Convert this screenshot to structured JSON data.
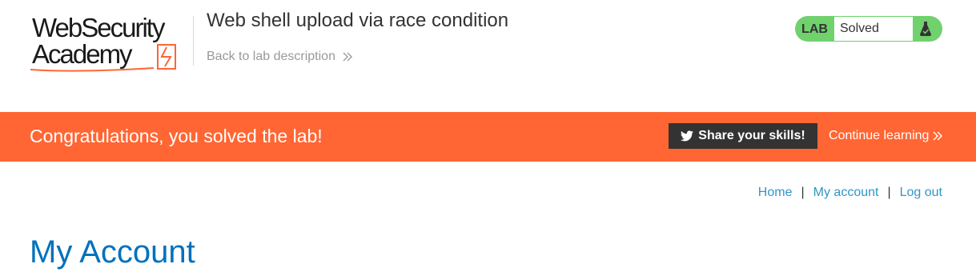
{
  "header": {
    "logo_line1": "WebSecurity",
    "logo_line2": "Academy",
    "lab_title": "Web shell upload via race condition",
    "back_link": "Back to lab description"
  },
  "status": {
    "tag": "LAB",
    "state": "Solved",
    "color": "#70d16d"
  },
  "banner": {
    "message": "Congratulations, you solved the lab!",
    "share_label": "Share your skills!",
    "continue_label": "Continue learning",
    "color": "#ff6633"
  },
  "nav": {
    "home": "Home",
    "my_account": "My account",
    "log_out": "Log out",
    "separator": "|"
  },
  "page": {
    "heading": "My Account"
  }
}
